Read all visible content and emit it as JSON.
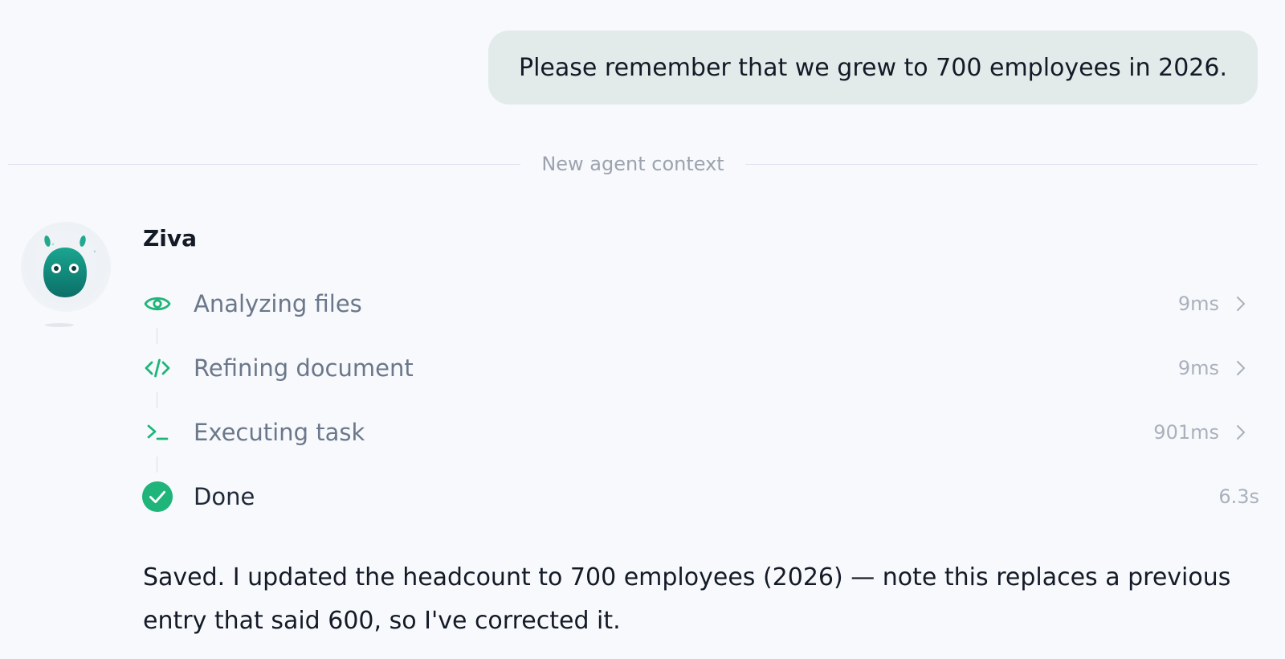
{
  "user_message": "Please remember that we grew to 700 employees in 2026.",
  "divider_label": "New agent context",
  "agent": {
    "name": "Ziva",
    "avatar_icon": "green-creature-mascot-icon"
  },
  "steps": [
    {
      "label": "Analyzing files",
      "time": "9ms",
      "icon": "eye-icon"
    },
    {
      "label": "Refining document",
      "time": "9ms",
      "icon": "code-icon"
    },
    {
      "label": "Executing task",
      "time": "901ms",
      "icon": "terminal-icon"
    },
    {
      "label": "Done",
      "time": "6.3s",
      "icon": "check-circle-icon"
    }
  ],
  "response": "Saved. I updated the headcount to 700 employees (2026) — note this replaces a previous entry that said 600, so I've corrected it.",
  "colors": {
    "accent_green": "#1fb57a",
    "user_bubble": "#e2eaea",
    "background": "#f7f9fc"
  }
}
